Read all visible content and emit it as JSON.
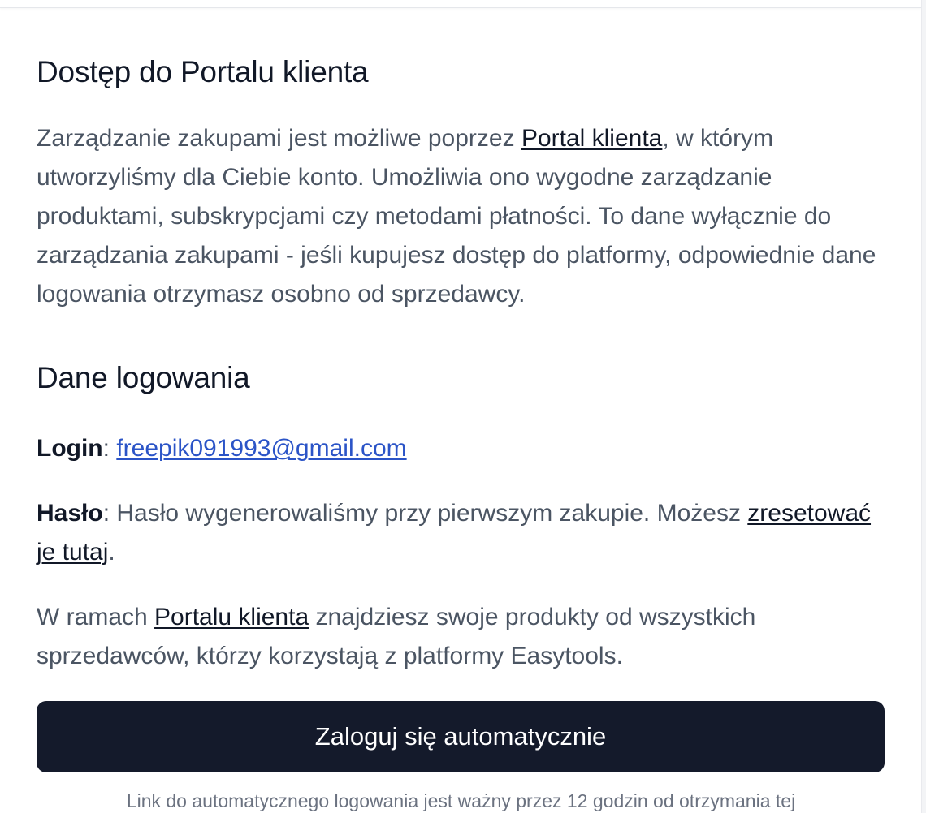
{
  "access_section": {
    "heading": "Dostęp do Portalu klienta",
    "intro_before_link": "Zarządzanie zakupami jest możliwe poprzez ",
    "intro_link": "Portal klienta",
    "intro_after_link": ", w którym utworzyliśmy dla Ciebie konto. Umożliwia ono wygodne zarządzanie produktami, subskrypcjami czy metodami płatności. To dane wyłącznie do zarządzania zakupami - jeśli kupujesz dostęp do platformy, odpowiednie dane logowania otrzymasz osobno od sprzedawcy."
  },
  "login_section": {
    "heading": "Dane logowania",
    "login_label": "Login",
    "login_separator": ": ",
    "login_value": "freepik091993@gmail.com",
    "password_label": "Hasło",
    "password_text": ": Hasło wygenerowaliśmy przy pierwszym zakupie. Możesz ",
    "password_link": "zresetować je tutaj",
    "password_end": ".",
    "portal_before_link": "W ramach ",
    "portal_link": "Portalu klienta",
    "portal_after_link": " znajdziesz swoje produkty od wszystkich sprzedawców, którzy korzystają z platformy Easytools."
  },
  "cta": {
    "label": "Zaloguj się automatycznie"
  },
  "note": {
    "text": "Link do automatycznego logowania jest ważny przez 12 godzin od otrzymania tej"
  },
  "colors": {
    "heading": "#111827",
    "body_text": "#4b5563",
    "email_link": "#2b54c7",
    "button_bg": "#141a2b",
    "button_text": "#ffffff"
  }
}
